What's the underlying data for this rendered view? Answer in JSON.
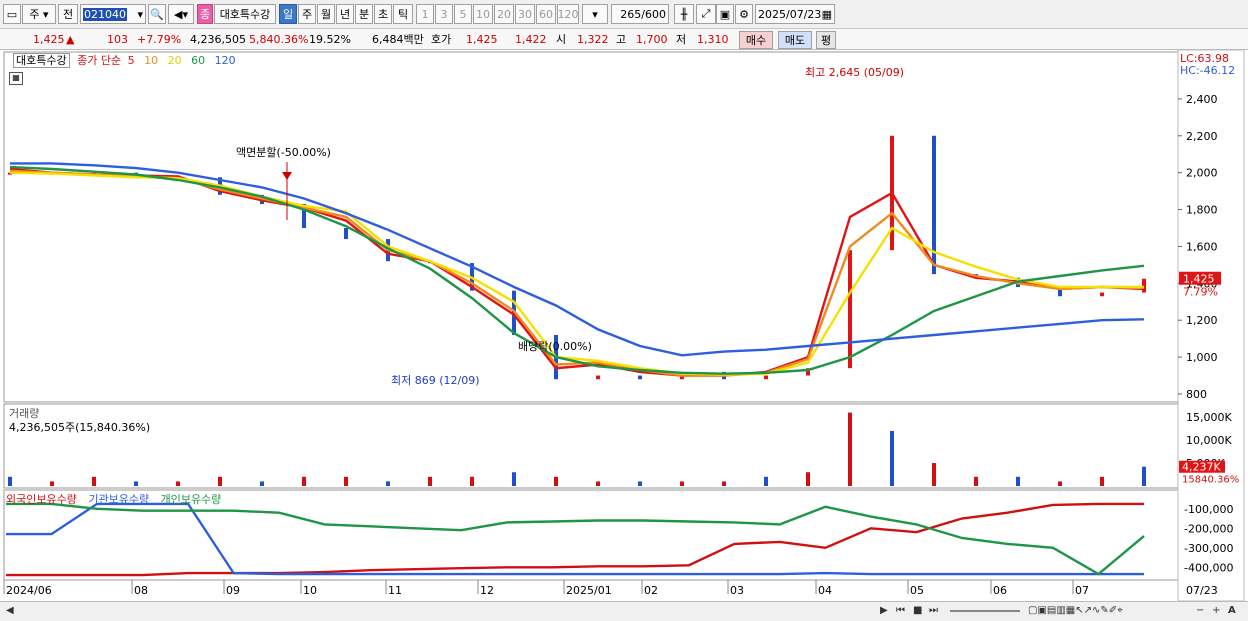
{
  "toolbar": {
    "market": "주",
    "prev": "전",
    "code": "021040",
    "name_badge": "종",
    "stock_name": "대호특수강",
    "periods": [
      "일",
      "주",
      "월",
      "년",
      "분",
      "초",
      "틱"
    ],
    "active_period": "일",
    "numbers": [
      "1",
      "3",
      "5",
      "10",
      "20",
      "30",
      "60",
      "120"
    ],
    "count": "265",
    "count_total": "/600",
    "date": "2025/07/23"
  },
  "info": {
    "price": "1,425",
    "change_arrow": "▲",
    "change": "103",
    "change_pct": "+7.79%",
    "volume": "4,236,505",
    "volume_pct": "5,840.36%",
    "turnover": "19.52%",
    "amount": "6,484백만",
    "hoga_label": "호가",
    "ask": "1,425",
    "bid": "1,422",
    "open_label": "시",
    "open": "1,322",
    "high_label": "고",
    "high": "1,700",
    "low_label": "저",
    "low": "1,310",
    "buy_btn": "매수",
    "sell_btn": "매도",
    "eval_btn": "평"
  },
  "legend": {
    "name": "대호특수강",
    "ma_label": "종가 단순",
    "ma": [
      {
        "label": "5",
        "color": "#e01414"
      },
      {
        "label": "10",
        "color": "#f08a1e"
      },
      {
        "label": "20",
        "color": "#f5e000"
      },
      {
        "label": "60",
        "color": "#1e9646"
      },
      {
        "label": "120",
        "color": "#2e5ee0"
      }
    ],
    "lc": "LC:63.98",
    "hc": "HC:-46.12"
  },
  "price_panel": {
    "y_ticks": [
      "2,400",
      "2,200",
      "2,000",
      "1,800",
      "1,600",
      "1,400",
      "1,200",
      "1,000",
      "800"
    ],
    "current_price": "1,425",
    "current_pct": "7.79%",
    "annot_high": "최고 2,645 (05/09)",
    "annot_low": "최저 869 (12/09)",
    "annot_split": "액면분할(-50.00%)",
    "annot_dividend": "배당락(0.00%)"
  },
  "volume_panel": {
    "title": "거래량",
    "value": "4,236,505주(15,840.36%)",
    "y_ticks": [
      "15,000K",
      "10,000K",
      "5,000K"
    ],
    "current": "4,237K",
    "current_pct": "15840.36%"
  },
  "holdings_panel": {
    "legends": [
      {
        "label": "외국인보유수량",
        "color": "#d01010"
      },
      {
        "label": "기관보유수량",
        "color": "#2e5ee0"
      },
      {
        "label": "개인보유수량",
        "color": "#1e9646"
      }
    ],
    "y_ticks": [
      "-100,000",
      "-200,000",
      "-300,000",
      "-400,000"
    ]
  },
  "x_axis": {
    "labels": [
      "2024/06",
      "08",
      "09",
      "10",
      "11",
      "12",
      "2025/01",
      "02",
      "03",
      "04",
      "05",
      "06",
      "07"
    ],
    "right_label": "07/23"
  },
  "chart_data": {
    "type": "line",
    "title": "",
    "xlabel": "",
    "ylabel": "",
    "ylim": [
      800,
      2600
    ],
    "series": [
      {
        "name": "5",
        "color": "#e01414",
        "values": [
          2020,
          2000,
          1990,
          1985,
          1980,
          1900,
          1850,
          1810,
          1740,
          1560,
          1520,
          1380,
          1230,
          940,
          960,
          920,
          900,
          900,
          920,
          1000,
          1760,
          1890,
          1500,
          1430,
          1410,
          1370,
          1380,
          1370
        ]
      },
      {
        "name": "10",
        "color": "#f08a1e",
        "values": [
          2010,
          2000,
          1990,
          1980,
          1970,
          1910,
          1860,
          1810,
          1760,
          1580,
          1520,
          1400,
          1250,
          960,
          970,
          930,
          900,
          900,
          915,
          990,
          1600,
          1780,
          1500,
          1440,
          1400,
          1370,
          1380,
          1375
        ]
      },
      {
        "name": "20",
        "color": "#f5e000",
        "values": [
          2000,
          1995,
          1985,
          1975,
          1970,
          1930,
          1870,
          1820,
          1790,
          1600,
          1520,
          1430,
          1300,
          1000,
          980,
          940,
          910,
          905,
          910,
          970,
          1350,
          1700,
          1570,
          1490,
          1420,
          1380,
          1380,
          1380
        ]
      },
      {
        "name": "60",
        "color": "#1e9646",
        "values": [
          2030,
          2020,
          2005,
          1990,
          1960,
          1920,
          1870,
          1800,
          1710,
          1590,
          1480,
          1320,
          1130,
          1000,
          950,
          930,
          915,
          910,
          915,
          930,
          1000,
          1120,
          1250,
          1330,
          1410,
          1440,
          1470,
          1495
        ]
      },
      {
        "name": "120",
        "color": "#2e5ee0",
        "values": [
          2050,
          2050,
          2040,
          2025,
          2000,
          1960,
          1920,
          1860,
          1780,
          1690,
          1590,
          1490,
          1380,
          1280,
          1150,
          1060,
          1010,
          1030,
          1040,
          1060,
          1080,
          1100,
          1120,
          1140,
          1160,
          1180,
          1200,
          1205
        ]
      }
    ],
    "candles_close": [
      2000,
      1990,
      2000,
      1985,
      1975,
      1880,
      1830,
      1700,
      1640,
      1520,
      1510,
      1360,
      1120,
      880,
      900,
      880,
      920,
      880,
      900,
      940,
      1580,
      2200,
      1450,
      1430,
      1380,
      1330,
      1350,
      1425
    ],
    "volume": [
      2,
      1,
      2,
      1,
      1,
      2,
      1,
      2,
      2,
      1,
      2,
      2,
      3,
      2,
      1,
      1,
      1,
      1,
      2,
      3,
      16,
      12,
      5,
      2,
      2,
      1,
      2,
      4.2
    ],
    "holdings": [
      {
        "name": "외국인보유수량",
        "color": "#d01010",
        "values": [
          -440000,
          -440000,
          -440000,
          -440000,
          -430000,
          -430000,
          -430000,
          -425000,
          -415000,
          -410000,
          -405000,
          -400000,
          -400000,
          -395000,
          -395000,
          -390000,
          -280000,
          -270000,
          -300000,
          -200000,
          -220000,
          -150000,
          -120000,
          -80000,
          -75000,
          -75000
        ]
      },
      {
        "name": "기관보유수량",
        "color": "#2e5ee0",
        "values": [
          -230000,
          -230000,
          -75000,
          -75000,
          -75000,
          -430000,
          -435000,
          -435000,
          -435000,
          -435000,
          -435000,
          -435000,
          -435000,
          -435000,
          -435000,
          -435000,
          -435000,
          -435000,
          -430000,
          -435000,
          -435000,
          -435000,
          -435000,
          -435000,
          -435000,
          -435000
        ]
      },
      {
        "name": "개인보유수량",
        "color": "#1e9646",
        "values": [
          -75000,
          -75000,
          -100000,
          -110000,
          -110000,
          -110000,
          -120000,
          -180000,
          -190000,
          -200000,
          -210000,
          -170000,
          -165000,
          -160000,
          -160000,
          -165000,
          -170000,
          -180000,
          -90000,
          -140000,
          -180000,
          -250000,
          -280000,
          -300000,
          -435000,
          -240000
        ]
      }
    ]
  }
}
